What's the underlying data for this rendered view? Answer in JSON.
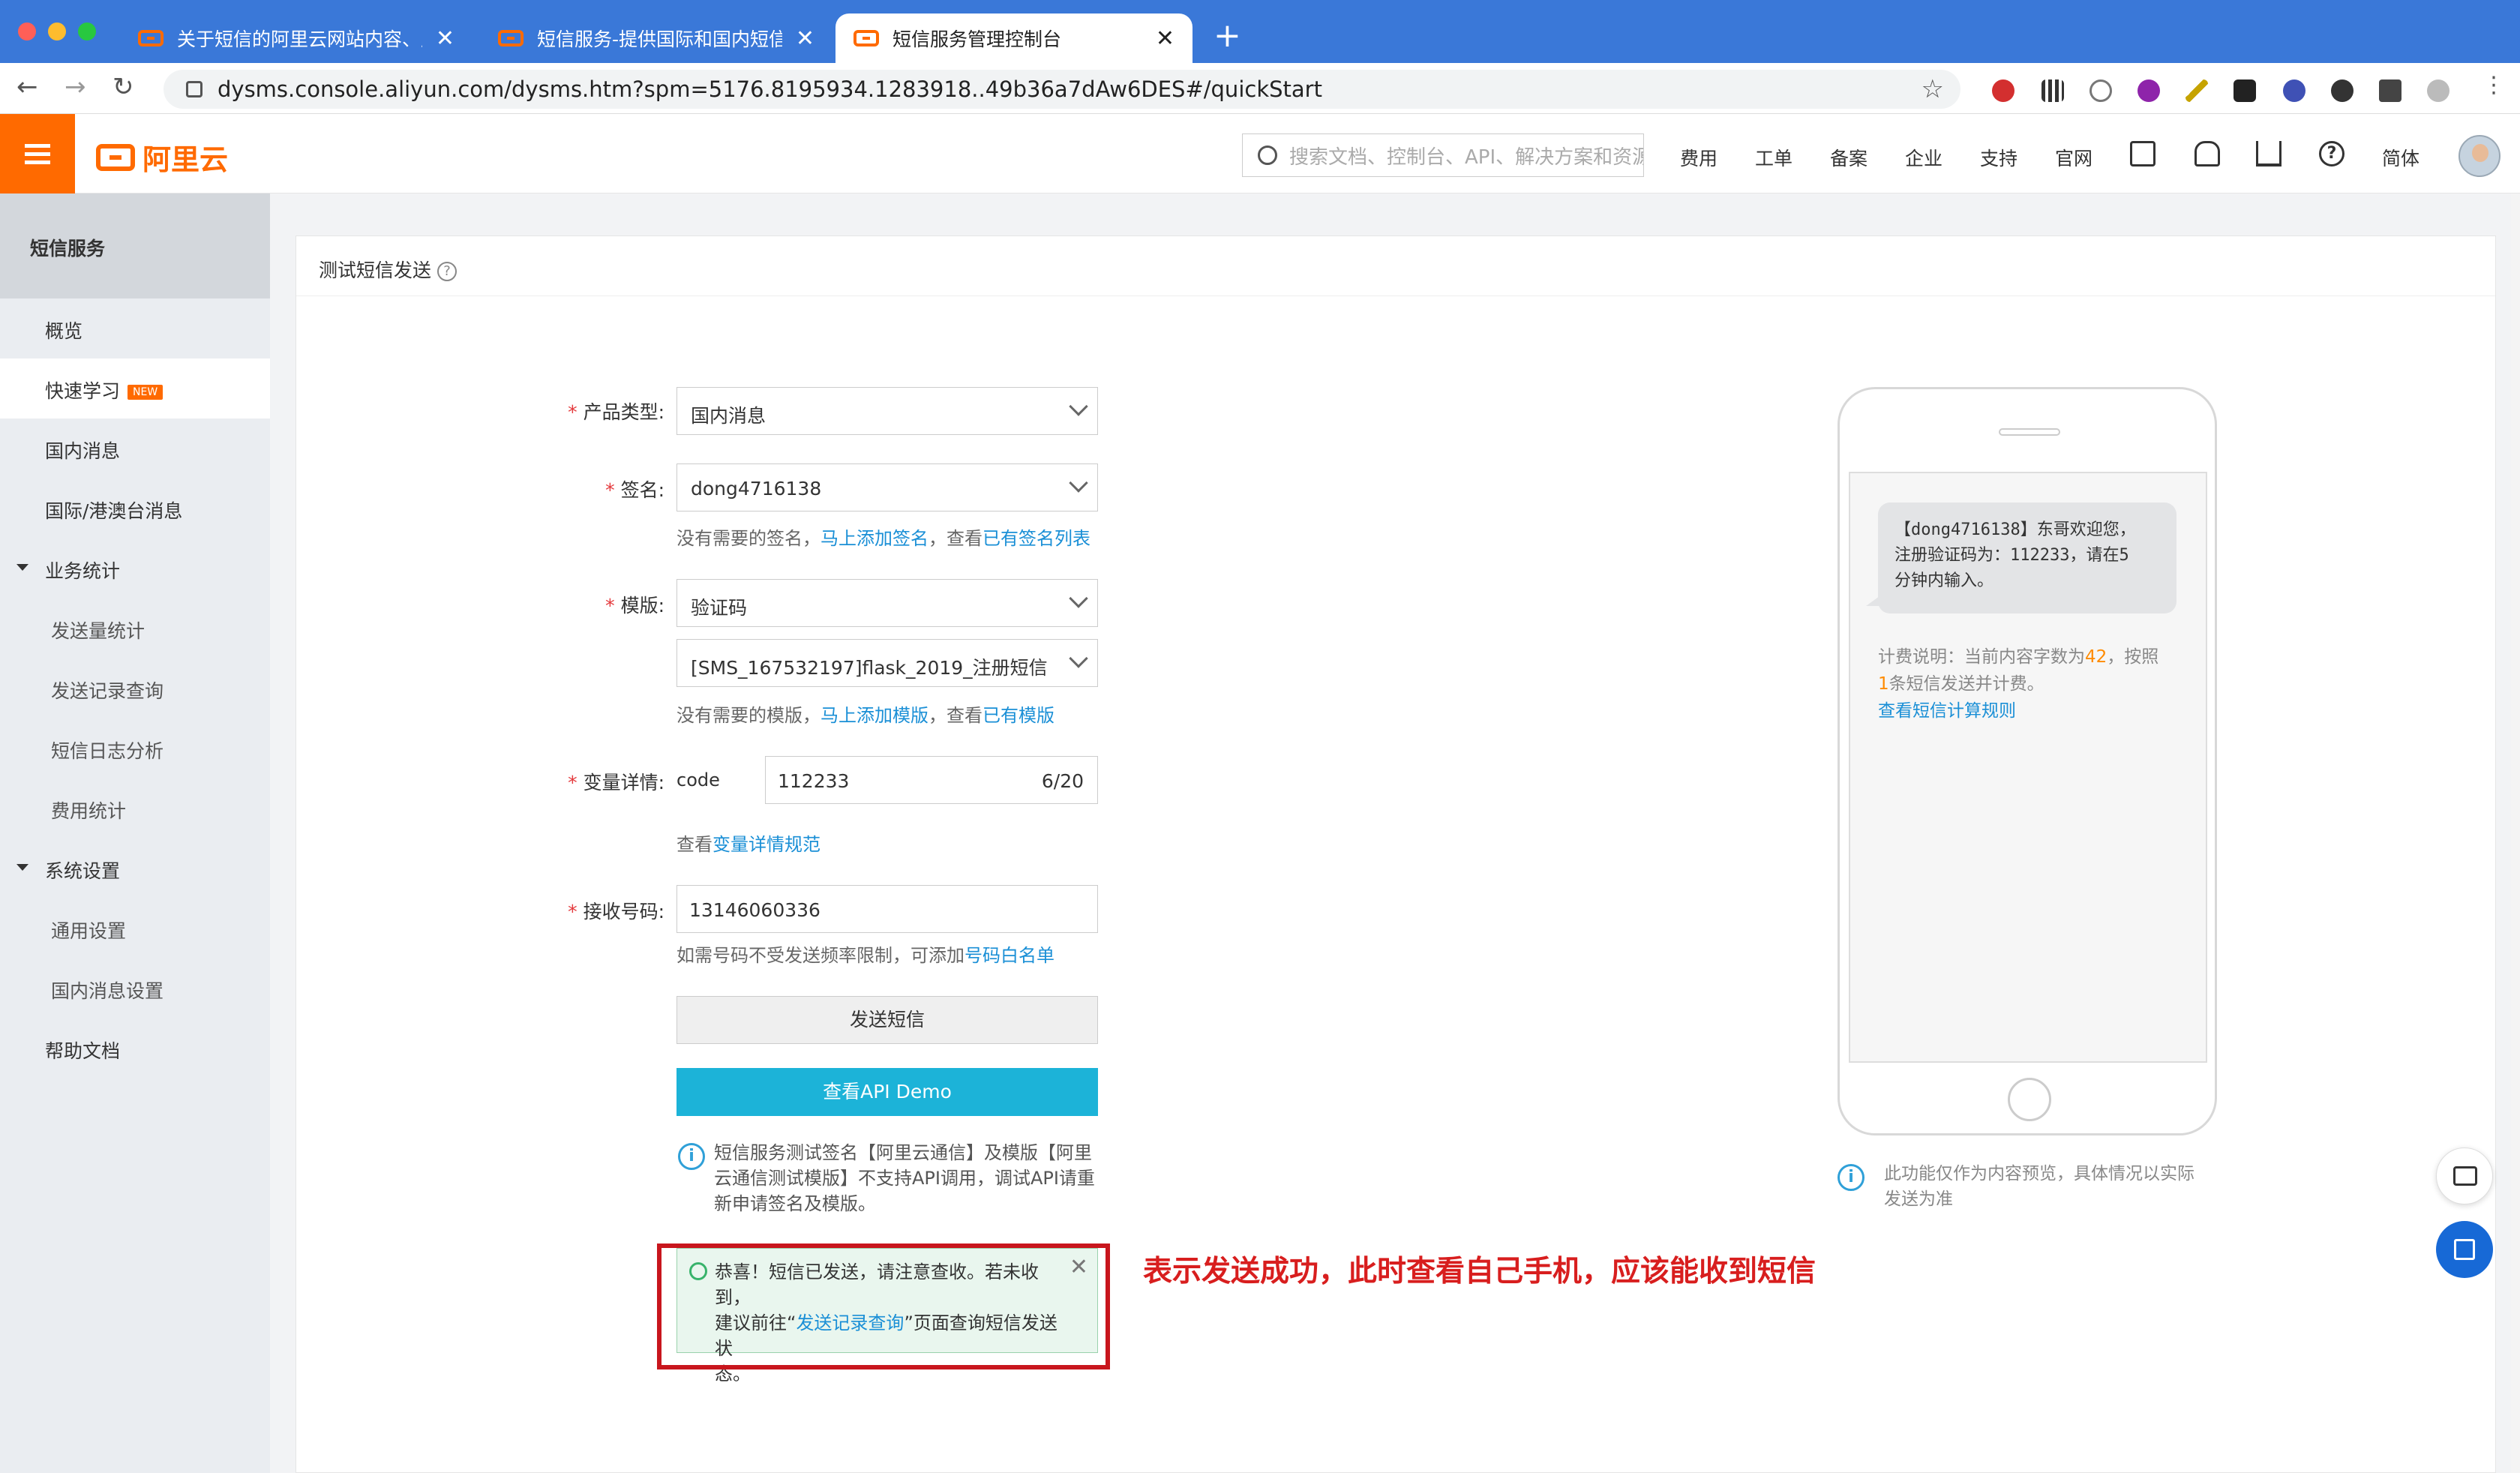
{
  "browser": {
    "tabs": [
      {
        "title": "关于短信的阿里云网站内容、产品",
        "active": false
      },
      {
        "title": "短信服务-提供国际和国内短信验证",
        "active": false
      },
      {
        "title": "短信服务管理控制台",
        "active": true
      }
    ],
    "url": "dysms.console.aliyun.com/dysms.htm?spm=5176.8195934.1283918..49b36a7dAw6DES#/quickStart",
    "url_domain_color": "#222222"
  },
  "header": {
    "logo_text": "阿里云",
    "search_placeholder": "搜索文档、控制台、API、解决方案和资源",
    "nav": [
      "费用",
      "工单",
      "备案",
      "企业",
      "支持",
      "官网"
    ],
    "lang": "简体",
    "icons": [
      "terminal-icon",
      "bell-icon",
      "cart-icon",
      "help-icon"
    ]
  },
  "sidebar": {
    "title": "短信服务",
    "items": [
      {
        "label": "概览",
        "type": "item"
      },
      {
        "label": "快速学习",
        "type": "item",
        "badge": "NEW",
        "active": true
      },
      {
        "label": "国内消息",
        "type": "item"
      },
      {
        "label": "国际/港澳台消息",
        "type": "item"
      },
      {
        "label": "业务统计",
        "type": "group"
      },
      {
        "label": "发送量统计",
        "type": "sub"
      },
      {
        "label": "发送记录查询",
        "type": "sub"
      },
      {
        "label": "短信日志分析",
        "type": "sub"
      },
      {
        "label": "费用统计",
        "type": "sub"
      },
      {
        "label": "系统设置",
        "type": "group"
      },
      {
        "label": "通用设置",
        "type": "sub"
      },
      {
        "label": "国内消息设置",
        "type": "sub"
      },
      {
        "label": "帮助文档",
        "type": "item"
      }
    ]
  },
  "panel": {
    "title": "测试短信发送",
    "form": {
      "product_label": "产品类型:",
      "product_value": "国内消息",
      "sign_label": "签名:",
      "sign_value": "dong4716138",
      "sign_hint_pre": "没有需要的签名，",
      "sign_hint_link1": "马上添加签名",
      "sign_hint_mid": "，查看",
      "sign_hint_link2": "已有签名列表",
      "template_label": "模版:",
      "template_value": "验证码",
      "template_select": "[SMS_167532197]flask_2019_注册短信",
      "template_hint_pre": "没有需要的模版，",
      "template_hint_link1": "马上添加模版",
      "template_hint_mid": "，查看",
      "template_hint_link2": "已有模版",
      "var_label": "变量详情:",
      "var_name": "code",
      "var_value": "112233",
      "var_count": "6/20",
      "var_hint_pre": "查看",
      "var_hint_link": "变量详情规范",
      "phone_label": "接收号码:",
      "phone_value": "13146060336",
      "phone_hint_pre": "如需号码不受发送频率限制，可添加",
      "phone_hint_link": "号码白名单",
      "send_button": "发送短信",
      "demo_button": "查看API Demo",
      "note_lines": [
        "短信服务测试签名【阿里云通信】及模版【阿里",
        "云通信测试模版】不支持API调用，调试API请重",
        "新申请签名及模版。"
      ],
      "success_line1": "恭喜！短信已发送，请注意查收。若未收到，",
      "success_line2_pre": "建议前往“",
      "success_line2_link": "发送记录查询",
      "success_line2_post": "”页面查询短信发送状",
      "success_line3": "态。"
    },
    "annotation": "表示发送成功，此时查看自己手机，应该能收到短信",
    "phone_preview": {
      "message_lines": [
        "【dong4716138】东哥欢迎您，",
        "注册验证码为：112233，请在5",
        "分钟内输入。"
      ],
      "fee_pre": "计费说明：当前内容字数为",
      "fee_count": "42",
      "fee_mid": "，按照",
      "fee_num2": "1",
      "fee_post": "条短信发送并计费。",
      "fee_link": "查看短信计算规则",
      "note_lines": [
        "此功能仅作为内容预览，具体情况以实际",
        "发送为准"
      ]
    }
  },
  "colors": {
    "brand": "#ff6a00",
    "link": "#1a8fd6",
    "primary_button": "#1cb3d8",
    "highlight_box": "#c8161d",
    "annotation": "#d81e1e",
    "success_bg": "#e9f6ee"
  }
}
